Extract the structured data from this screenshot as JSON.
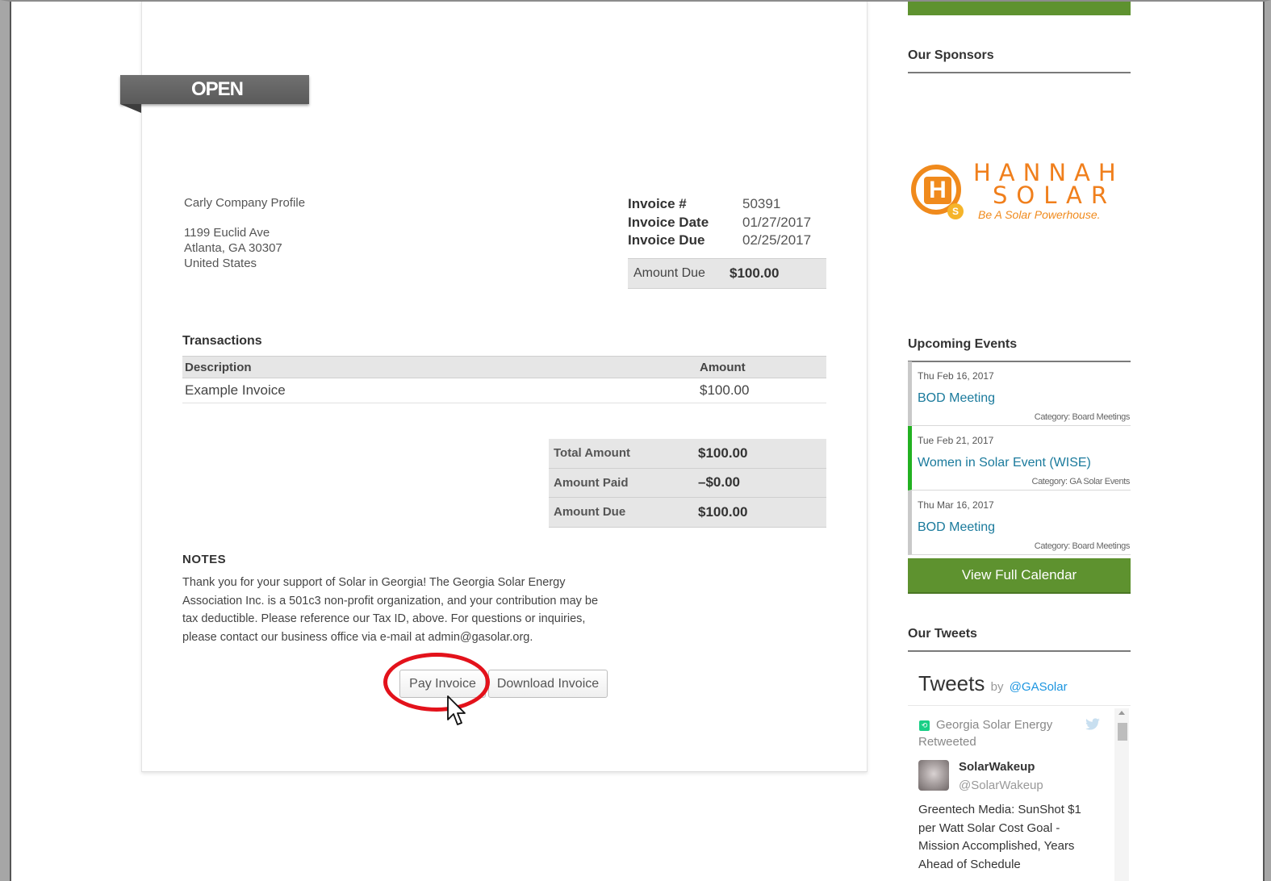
{
  "invoice": {
    "status": "OPEN",
    "bill_to": {
      "company": "Carly Company Profile",
      "address_line1": "1199 Euclid Ave",
      "address_line2": "Atlanta, GA 30307",
      "country": "United States"
    },
    "meta": [
      {
        "label": "Invoice #",
        "value": "50391"
      },
      {
        "label": "Invoice Date",
        "value": "01/27/2017"
      },
      {
        "label": "Invoice Due",
        "value": "02/25/2017"
      }
    ],
    "amount_due_box": {
      "label": "Amount Due",
      "value": "$100.00"
    },
    "transactions": {
      "title": "Transactions",
      "columns": [
        "Description",
        "Amount"
      ],
      "rows": [
        {
          "description": "Example Invoice",
          "amount": "$100.00"
        }
      ]
    },
    "totals": [
      {
        "label": "Total Amount",
        "value": "$100.00"
      },
      {
        "label": "Amount Paid",
        "value": "–$0.00"
      },
      {
        "label": "Amount Due",
        "value": "$100.00"
      }
    ],
    "notes": {
      "title": "NOTES",
      "text": "Thank you for your support of Solar in Georgia! The Georgia Solar Energy Association Inc. is a 501c3 non-profit organization, and your contribution may be tax deductible. Please reference our Tax ID, above. For questions or inquiries, please contact our business office via e-mail at admin@gasolar.org."
    },
    "buttons": {
      "pay": "Pay Invoice",
      "download": "Download Invoice"
    },
    "highlight_color": "#e3121b"
  },
  "sidebar": {
    "sponsors_heading": "Our Sponsors",
    "sponsor_logo": {
      "mark_letter": "H",
      "badge_letter": "S",
      "name_line1": "HANNAH",
      "name_line2": "SOLAR",
      "tagline": "Be A Solar Powerhouse."
    },
    "events_heading": "Upcoming Events",
    "events": [
      {
        "date": "Thu Feb 16, 2017",
        "title": "BOD Meeting",
        "category": "Category: Board Meetings"
      },
      {
        "date": "Tue Feb 21, 2017",
        "title": "Women in Solar Event (WISE)",
        "category": "Category: GA Solar Events"
      },
      {
        "date": "Thu Mar 16, 2017",
        "title": "BOD Meeting",
        "category": "Category: Board Meetings"
      }
    ],
    "calendar_button": "View Full Calendar",
    "tweets_heading": "Our Tweets",
    "tweets": {
      "header": "Tweets",
      "by": "by",
      "handle": "@GASolar",
      "retweeter_line1": "Georgia Solar Energy",
      "retweeter_line2": "Retweeted",
      "user": "SolarWakeup",
      "user_handle": "@SolarWakeup",
      "text": "Greentech Media: SunShot $1 per Watt Solar Cost Goal - Mission Accomplished, Years Ahead of Schedule"
    },
    "accent_green": "#5e922f",
    "link_color": "#1a7a9c"
  }
}
